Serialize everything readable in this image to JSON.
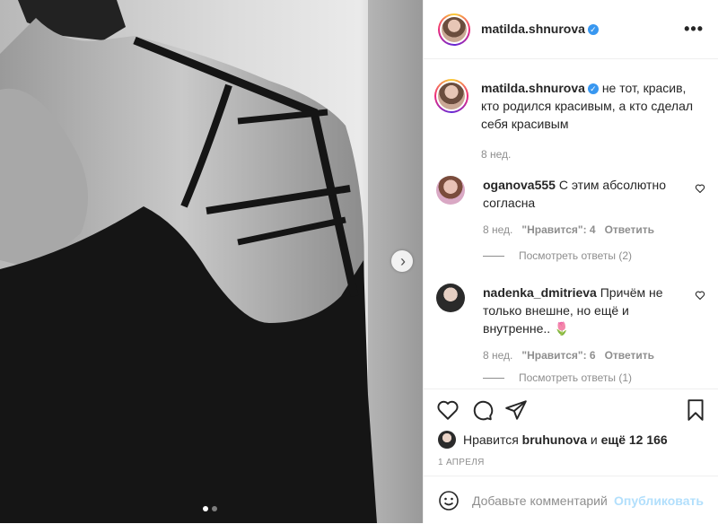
{
  "post": {
    "author": "matilda.shnurova",
    "verified_symbol": "✓",
    "more_icon": "•••",
    "carousel": {
      "next_icon": "›",
      "slide_count": 2,
      "active_slide": 1
    }
  },
  "caption": {
    "username": "matilda.shnurova",
    "text": "не тот, красив, кто родился красивым, а кто сделал себя красивым",
    "time": "8 нед."
  },
  "comments": [
    {
      "username": "oganova555",
      "text": "С этим абсолютно согласна",
      "time": "8 нед.",
      "likes": "\"Нравится\": 4",
      "reply_label": "Ответить",
      "view_replies": "Посмотреть ответы (2)"
    },
    {
      "username": "nadenka_dmitrieva",
      "text": "Причём не только внешне, но ещё и внутренне.. 🌷",
      "time": "8 нед.",
      "likes": "\"Нравится\": 6",
      "reply_label": "Ответить",
      "view_replies": "Посмотреть ответы (1)"
    }
  ],
  "likes": {
    "prefix": "Нравится",
    "user": "bruhunova",
    "conjunction": "и",
    "others": "ещё 12 166"
  },
  "date": "1 АПРЕЛЯ",
  "add_comment": {
    "placeholder": "Добавьте комментарий...",
    "publish_label": "Опубликовать"
  },
  "colors": {
    "link_blue": "#3897f0",
    "publish_disabled": "#b2dffc",
    "secondary_text": "#8e8e8e"
  }
}
